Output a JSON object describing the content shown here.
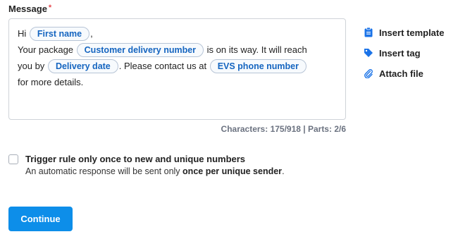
{
  "message": {
    "label": "Message",
    "required_mark": "*",
    "segments": {
      "greeting": "Hi",
      "tag_first_name": "First name",
      "comma": ",",
      "line2_start": "Your package",
      "tag_delivery_number": "Customer delivery number",
      "line2_end": "is on its way. It will reach",
      "line3_start": "you by",
      "tag_delivery_date": "Delivery date",
      "line3_mid": ". Please contact us at",
      "tag_phone": "EVS phone number",
      "line4": "for more details."
    },
    "counter": "Characters: 175/918 | Parts: 2/6"
  },
  "actions": {
    "insert_template": "Insert template",
    "insert_tag": "Insert tag",
    "attach_file": "Attach file"
  },
  "trigger": {
    "title": "Trigger rule only once to new and unique numbers",
    "desc_start": "An automatic response will be sent only",
    "desc_bold": "once per unique sender",
    "desc_end": "."
  },
  "continue_label": "Continue",
  "colors": {
    "accent": "#0d8ee9",
    "tag_text": "#1565c0",
    "required": "#e5484d"
  }
}
